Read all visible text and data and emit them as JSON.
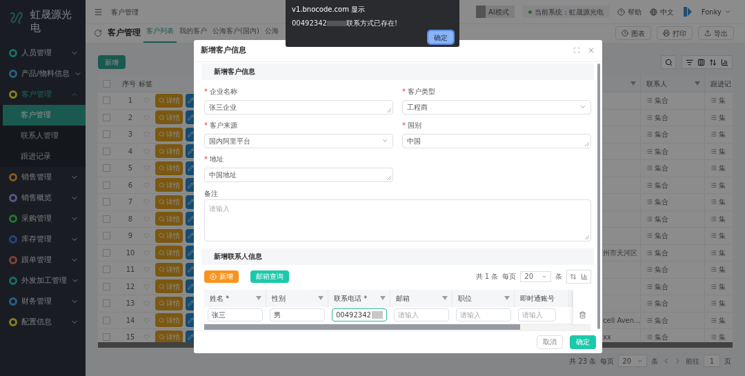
{
  "sidebar": {
    "logo_text": "虹晟源光电",
    "items": [
      {
        "label": "人员管理",
        "color": "#176d62",
        "expanded": false,
        "selected": false
      },
      {
        "label": "产品/物料信息",
        "color": "#236284",
        "expanded": false,
        "selected": false
      },
      {
        "label": "客户管理",
        "color": "#857e23",
        "expanded": true,
        "selected": true,
        "children": [
          {
            "label": "客户管理",
            "selected": true
          },
          {
            "label": "联系人管理",
            "selected": false
          },
          {
            "label": "跟进记录",
            "selected": false
          }
        ]
      },
      {
        "label": "销售管理",
        "color": "#885823",
        "expanded": false,
        "selected": false
      },
      {
        "label": "销售概览",
        "color": "#605388",
        "expanded": false,
        "selected": false
      },
      {
        "label": "采购管理",
        "color": "#24742f",
        "expanded": false,
        "selected": false
      },
      {
        "label": "库存管理",
        "color": "#234384",
        "expanded": false,
        "selected": false
      },
      {
        "label": "跟单管理",
        "color": "#844037",
        "expanded": false,
        "selected": false
      },
      {
        "label": "外发加工管理",
        "color": "#176d62",
        "expanded": false,
        "selected": false
      },
      {
        "label": "财务管理",
        "color": "#236284",
        "expanded": false,
        "selected": false
      },
      {
        "label": "配置信息",
        "color": "#857e23",
        "expanded": false,
        "selected": false
      }
    ]
  },
  "topbar": {
    "breadcrumb": "客户管理",
    "ai_mode": {
      "label": "AI模式",
      "on": false
    },
    "system": "当前系统：虹晟源光电",
    "help": "帮助",
    "language": "中文",
    "user": "Fonky"
  },
  "page": {
    "title": "客户管理",
    "tabs": [
      {
        "label": "客户列表",
        "selected": true
      },
      {
        "label": "我的客户",
        "selected": false
      },
      {
        "label": "公海客户(国内)",
        "selected": false
      },
      {
        "label": "公海",
        "selected": false
      }
    ],
    "actions": [
      "图表",
      "打印",
      "导出"
    ],
    "add_button": "新增"
  },
  "table": {
    "header_checked": false,
    "columns": [
      "序号",
      "标签"
    ],
    "right_columns": [
      "联系人",
      "跟进记"
    ],
    "rows": [
      {
        "checked": false,
        "index": "1",
        "detail": "详情",
        "contact": "集合",
        "follow": "集"
      },
      {
        "checked": false,
        "index": "2",
        "detail": "详情",
        "contact": "集合",
        "follow": "集"
      },
      {
        "checked": false,
        "index": "3",
        "detail": "详情",
        "contact": "集合",
        "follow": "集"
      },
      {
        "checked": false,
        "index": "4",
        "detail": "详情",
        "contact": "集合",
        "follow": "集"
      },
      {
        "checked": false,
        "index": "5",
        "detail": "详情",
        "contact": "集合",
        "follow": "集"
      },
      {
        "checked": false,
        "index": "6",
        "detail": "详情",
        "contact": "集合",
        "follow": "集"
      },
      {
        "checked": false,
        "index": "7",
        "detail": "详情",
        "contact": "集合",
        "follow": "集"
      },
      {
        "checked": false,
        "index": "8",
        "detail": "详情",
        "contact": "集合",
        "follow": "集"
      },
      {
        "checked": false,
        "index": "9",
        "detail": "详情",
        "contact": "集合",
        "follow": "集"
      },
      {
        "checked": false,
        "index": "10",
        "detail": "详情",
        "address": "州市天河区",
        "contact": "集合",
        "follow": "集"
      },
      {
        "checked": false,
        "index": "11",
        "detail": "详情",
        "contact": "集合",
        "follow": "集"
      },
      {
        "checked": false,
        "index": "12",
        "detail": "详情",
        "contact": "集合",
        "follow": "集"
      },
      {
        "checked": false,
        "index": "13",
        "detail": "详情",
        "contact": "集合",
        "follow": "集"
      },
      {
        "checked": false,
        "index": "14",
        "detail": "详情",
        "address": "cell Aven...",
        "contact": "集合",
        "follow": "集"
      },
      {
        "checked": false,
        "index": "15",
        "detail": "详情",
        "address": "xx",
        "contact": "集合",
        "follow": "集"
      }
    ],
    "pagination": {
      "total": "共 23 条",
      "per_page_label": "每页",
      "per_page": "20",
      "unit": "条",
      "goto": "前往",
      "page": "1",
      "page_unit": "页"
    }
  },
  "modal": {
    "title": "新增客户信息",
    "section": "新增客户信息",
    "fields": [
      {
        "required_mark": "*",
        "label": "企业名称",
        "kind": "text",
        "value": "张三企业"
      },
      {
        "required_mark": "*",
        "label": "客户类型",
        "kind": "select",
        "value": "工程商"
      },
      {
        "required_mark": "*",
        "label": "客户来源",
        "kind": "select",
        "value": "国内阿里平台"
      },
      {
        "required_mark": "*",
        "label": "国别",
        "kind": "text",
        "value": "中国"
      },
      {
        "required_mark": "*",
        "label": "地址",
        "kind": "text",
        "value": "中国地址"
      }
    ],
    "note": {
      "label": "备注",
      "placeholder": "请输入"
    },
    "contact_section": "新增联系人信息",
    "add_button": "新增",
    "email_button": "邮箱查询",
    "contact_pagination": {
      "total": "共 1 条",
      "per_page_label": "每页",
      "per_page": "20",
      "unit": "条"
    },
    "contact_columns": [
      {
        "label": "姓名 *",
        "filter": true
      },
      {
        "label": "性别",
        "filter": true
      },
      {
        "label": "联系电话 *",
        "filter": true
      },
      {
        "label": "邮箱",
        "filter": true
      },
      {
        "label": "职位",
        "filter": true
      },
      {
        "label": "即时通账号",
        "filter": false
      }
    ],
    "contact_row": [
      {
        "value": "张三",
        "focused": false
      },
      {
        "value": "男",
        "focused": false
      },
      {
        "value": "00492342",
        "redacted": true,
        "focused": true
      },
      {
        "placeholder": "请输入",
        "focused": false
      },
      {
        "placeholder": "请输入",
        "focused": false
      },
      {
        "placeholder": "请输入",
        "focused": false
      }
    ],
    "cancel": "取消",
    "confirm": "确定"
  },
  "alert": {
    "title": "v1.bnocode.com 显示",
    "message_start": "00492342",
    "message_end": "联系方式已存在!",
    "button": "确定"
  }
}
